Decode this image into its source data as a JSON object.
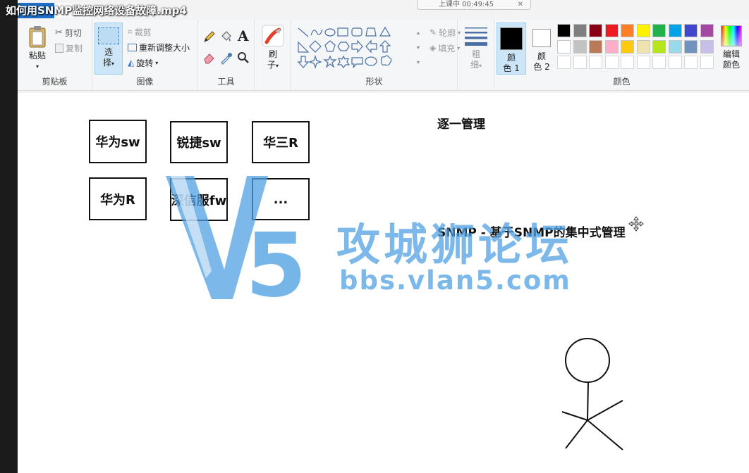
{
  "video_title": "如何用SNMP监控网络设备故障.mp4",
  "time_pill": {
    "text": "上课中 00:49:45",
    "close": "✕"
  },
  "ribbon": {
    "clipboard": {
      "paste": "粘贴",
      "cut": "剪切",
      "copy": "复制",
      "label": "剪贴板"
    },
    "image": {
      "select_1": "选",
      "select_2": "择",
      "crop": "裁剪",
      "resize": "重新调整大小",
      "rotate": "旋转",
      "label": "图像"
    },
    "tools": {
      "label": "工具"
    },
    "brush": {
      "line1": "刷",
      "line2": "子"
    },
    "shapes": {
      "outline": "轮廓",
      "fill": "填充",
      "label": "形状"
    },
    "size": {
      "line1": "粗",
      "line2": "细"
    },
    "color1": {
      "line1": "颜",
      "line2": "色 1",
      "value": "#000000"
    },
    "color2": {
      "line1": "颜",
      "line2": "色 2",
      "value": "#ffffff"
    },
    "palette": {
      "label": "颜色",
      "row1": [
        "#000000",
        "#7f7f7f",
        "#880015",
        "#ed1c24",
        "#ff7f27",
        "#fff200",
        "#22b14c",
        "#00a2e8",
        "#3f48cc",
        "#a349a4"
      ],
      "row2": [
        "#ffffff",
        "#c3c3c3",
        "#b97a57",
        "#ffaec9",
        "#ffc90e",
        "#efe4b0",
        "#b5e61d",
        "#99d9ea",
        "#7092be",
        "#c8bfe7"
      ],
      "row3": [
        "#ffffff",
        "#ffffff",
        "#ffffff",
        "#ffffff",
        "#ffffff",
        "#ffffff",
        "#ffffff",
        "#ffffff",
        "#ffffff",
        "#ffffff"
      ]
    },
    "edit_colors": {
      "line1": "编辑",
      "line2": "颜色"
    }
  },
  "canvas": {
    "nodes": [
      "华为sw",
      "锐捷sw",
      "华三R",
      "华为R",
      "深信服fw",
      "..."
    ],
    "heading": "逐一管理",
    "snmp_text": "SNMP - 基于SNMP的集中式管理"
  },
  "watermark": {
    "badge": "V5",
    "title": "攻城狮论坛",
    "url": "bbs.vlan5.com"
  }
}
